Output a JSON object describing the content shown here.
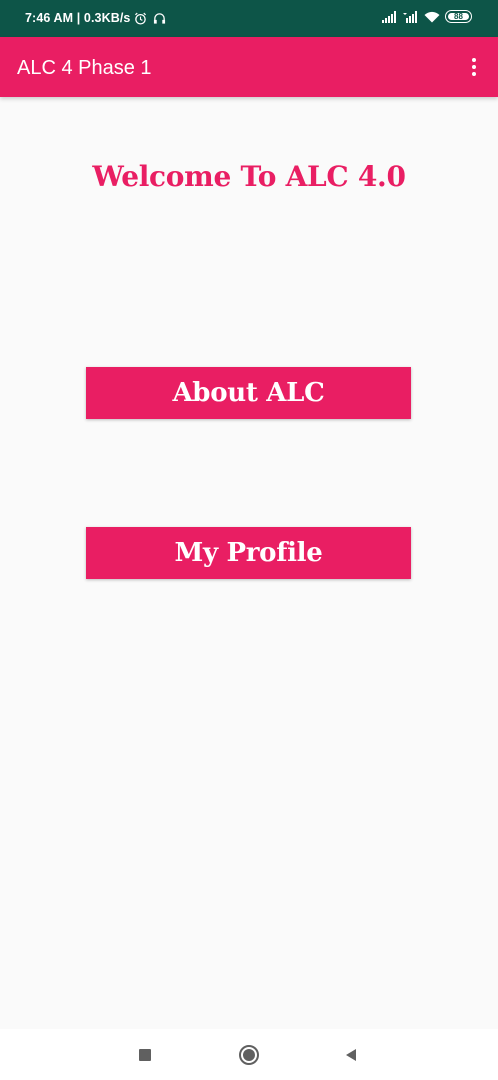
{
  "status_bar": {
    "time_speed": "7:46 AM | 0.3KB/s",
    "icons": [
      "alarm-icon",
      "headset-icon",
      "signal-icon",
      "signal-icon",
      "wifi-icon",
      "battery-icon"
    ],
    "battery_level": "88",
    "background_color": "#0d5548"
  },
  "app_bar": {
    "title": "ALC 4 Phase 1",
    "menu_icon": "more-vert-icon",
    "color": "#e91e63"
  },
  "main": {
    "welcome_text": "Welcome To ALC 4.0",
    "buttons": [
      {
        "label": "About ALC"
      },
      {
        "label": "My Profile"
      }
    ],
    "accent_color": "#e91e63"
  },
  "nav_bar": {
    "icons": [
      "recents-icon",
      "home-icon",
      "back-icon"
    ]
  }
}
